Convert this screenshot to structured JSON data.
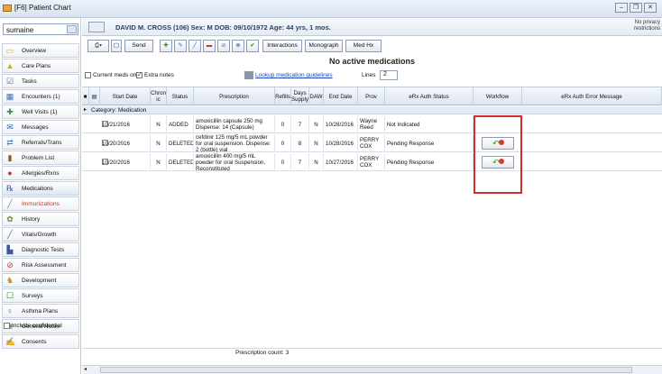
{
  "window": {
    "title": "[F6] Patient Chart",
    "buttons": [
      "–",
      "❐",
      "✕"
    ]
  },
  "patient_search": {
    "value": "sumaine"
  },
  "patient_bar": {
    "info": "DAVID M. CROSS (106)  Sex: M  DOB: 09/10/1972  Age: 44 yrs, 1 mos.",
    "privacy": [
      "No privacy",
      "restrictions"
    ]
  },
  "nav": [
    {
      "label": "Overview",
      "icon": "overview-icon",
      "glyph": "▭",
      "color": "#e1a33a"
    },
    {
      "label": "Care Plans",
      "icon": "care-plans-icon",
      "glyph": "▲",
      "color": "#e0a10c"
    },
    {
      "label": "Tasks",
      "icon": "tasks-icon",
      "glyph": "☑",
      "color": "#5a6a80"
    },
    {
      "label": "Encounters (1)",
      "icon": "encounters-icon",
      "glyph": "▦",
      "color": "#3b6db3"
    },
    {
      "label": "Well Visits (1)",
      "icon": "well-visits-icon",
      "glyph": "✚",
      "color": "#3b8a3b"
    },
    {
      "label": "Messages",
      "icon": "messages-icon",
      "glyph": "✉",
      "color": "#2f5fae"
    },
    {
      "label": "Referrals/Trans",
      "icon": "referrals-icon",
      "glyph": "⇄",
      "color": "#4a7ac1"
    },
    {
      "label": "Problem List",
      "icon": "problem-list-icon",
      "glyph": "▮",
      "color": "#8c5a2b"
    },
    {
      "label": "Allergies/Rxns",
      "icon": "allergies-icon",
      "glyph": "●",
      "color": "#c0392b"
    },
    {
      "label": "Medications",
      "icon": "medications-icon",
      "glyph": "℞",
      "color": "#2c5aa0"
    },
    {
      "label": "Immunizations",
      "icon": "immunizations-icon",
      "glyph": "╱",
      "color": "#888888"
    },
    {
      "label": "History",
      "icon": "history-icon",
      "glyph": "✿",
      "color": "#6a8a2a"
    },
    {
      "label": "Vitals/Growth",
      "icon": "vitals-icon",
      "glyph": "╱",
      "color": "#6a6a8a"
    },
    {
      "label": "Diagnostic Tests",
      "icon": "diagnostic-tests-icon",
      "glyph": "▙",
      "color": "#3a5a9a"
    },
    {
      "label": "Risk Assessment",
      "icon": "risk-assessment-icon",
      "glyph": "⊘",
      "color": "#c0392b"
    },
    {
      "label": "Development",
      "icon": "development-icon",
      "glyph": "♞",
      "color": "#d08a2a"
    },
    {
      "label": "Surveys",
      "icon": "surveys-icon",
      "glyph": "☐",
      "color": "#2c7a2c"
    },
    {
      "label": "Asthma Plans",
      "icon": "asthma-plans-icon",
      "glyph": "♀",
      "color": "#3a6a3a"
    },
    {
      "label": "General Notes",
      "icon": "general-notes-icon",
      "glyph": "❀",
      "color": "#4a7a3a"
    },
    {
      "label": "Consents",
      "icon": "consents-icon",
      "glyph": "✍",
      "color": "#c05a1a"
    }
  ],
  "include_confidential": "Include confidential",
  "toolbar": {
    "send": "Send",
    "interactions": "Interactions",
    "monograph": "Monograph",
    "medhx": "Med Hx"
  },
  "no_active": "No active medications",
  "filters": {
    "current_meds": "Current meds only",
    "extra_notes": "Extra notes",
    "link": "Lookup medication guidelines",
    "lines_label": "Lines",
    "lines_value": "2"
  },
  "columns": [
    "Start Date",
    "Chron ic",
    "Status",
    "Prescription",
    "Refills",
    "Days Supply",
    "DAW",
    "End Date",
    "Prov",
    "eRx Auth Status",
    "Workflow",
    "eRx Auth Error Message"
  ],
  "category": "Category: Medication",
  "rows": [
    {
      "start": "10/21/2016",
      "chronic": "N",
      "status": "ADDED",
      "rx": "amoxicillin capsule 250 mg Dispense: 14 (Capsule)",
      "refills": "0",
      "days": "7",
      "daw": "N",
      "end": "10/28/2016",
      "prov": "Wayne Reed",
      "auth": "Not Indicated"
    },
    {
      "start": "10/20/2016",
      "chronic": "N",
      "status": "DELETED",
      "rx": "cefdinir 125 mg/5 mL powder for oral suspension. Dispense: 2 (bottle) vial",
      "refills": "0",
      "days": "8",
      "daw": "N",
      "end": "10/28/2016",
      "prov": "PERRY COX",
      "auth": "Pending Response"
    },
    {
      "start": "10/20/2016",
      "chronic": "N",
      "status": "DELETED",
      "rx": "amoxicillin 400 mg/5 mL powder for oral Suspension, Reconstituted",
      "refills": "0",
      "days": "7",
      "daw": "N",
      "end": "10/27/2016",
      "prov": "PERRY COX",
      "auth": "Pending Response"
    }
  ],
  "footer": {
    "count": "Prescription count: 3"
  }
}
